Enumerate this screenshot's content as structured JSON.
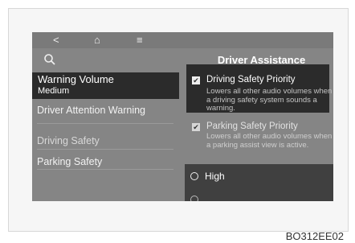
{
  "nav": {
    "back_glyph": "<",
    "home_glyph": "⌂",
    "menu_glyph": "≡"
  },
  "header": {
    "title": "Driver Assistance"
  },
  "menu": {
    "warning_volume": "Warning Volume",
    "warning_volume_value": "Medium",
    "driver_attention": "Driver Attention Warning",
    "driving_safety": "Driving Safety",
    "parking_safety": "Parking Safety"
  },
  "options": {
    "driving_priority": {
      "label": "Driving Safety Priority",
      "desc": "Lowers all other audio volumes when a driving safety system sounds a warning.",
      "checked": true
    },
    "parking_priority": {
      "label": "Parking Safety Priority",
      "desc": "Lowers all other audio volumes when a parking assist view is active.",
      "checked": true
    },
    "volume_high": "High"
  },
  "caption": "BO312EE02",
  "colors": {
    "screen_bg": "#858585",
    "panel_dark": "#2b2b2b",
    "accent_text": "#ffffff"
  }
}
